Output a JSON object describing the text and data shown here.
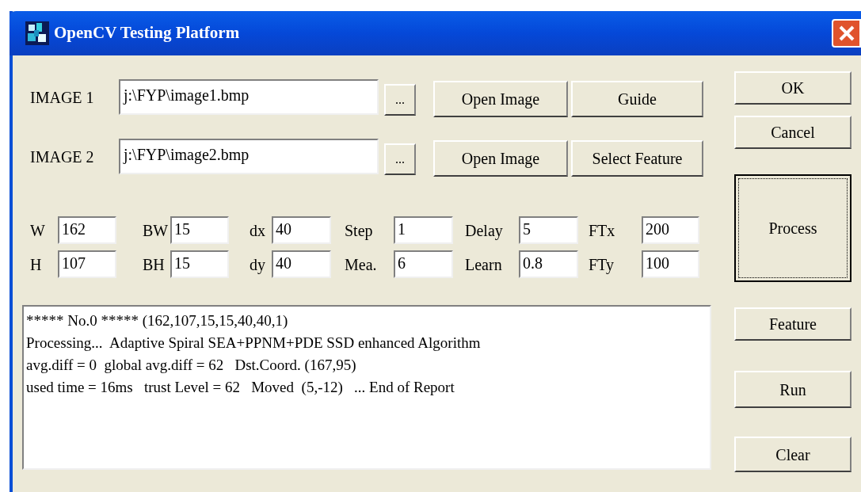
{
  "window": {
    "title": "OpenCV Testing Platform"
  },
  "images": [
    {
      "label": "IMAGE 1",
      "path": "j:\\FYP\\image1.bmp",
      "browse": "...",
      "buttons": [
        "Open Image",
        "Guide"
      ]
    },
    {
      "label": "IMAGE 2",
      "path": "j:\\FYP\\image2.bmp",
      "browse": "...",
      "buttons": [
        "Open Image",
        "Select Feature"
      ]
    }
  ],
  "params": [
    [
      {
        "label": "W",
        "value": "162"
      },
      {
        "label": "BW",
        "value": "15"
      },
      {
        "label": "dx",
        "value": "40"
      },
      {
        "label": "Step",
        "value": "1"
      },
      {
        "label": "Delay",
        "value": "5"
      },
      {
        "label": "FTx",
        "value": "200"
      }
    ],
    [
      {
        "label": "H",
        "value": "107"
      },
      {
        "label": "BH",
        "value": "15"
      },
      {
        "label": "dy",
        "value": "40"
      },
      {
        "label": "Mea.",
        "value": "6"
      },
      {
        "label": "Learn",
        "value": "0.8"
      },
      {
        "label": "FTy",
        "value": "100"
      }
    ]
  ],
  "log": [
    "***** No.0 ***** (162,107,15,15,40,40,1)",
    "Processing...  Adaptive Spiral SEA+PPNM+PDE SSD enhanced Algorithm",
    "avg.diff = 0  global avg.diff = 62   Dst.Coord. (167,95)",
    "used time = 16ms   trust Level = 62   Moved  (5,-12)   ... End of Report"
  ],
  "side_buttons": [
    {
      "label": "OK",
      "default": false
    },
    {
      "label": "Cancel",
      "default": false
    },
    {
      "label": "Process",
      "default": true
    },
    {
      "label": "Feature",
      "default": false
    },
    {
      "label": "Run",
      "default": false
    },
    {
      "label": "Clear",
      "default": false
    }
  ]
}
